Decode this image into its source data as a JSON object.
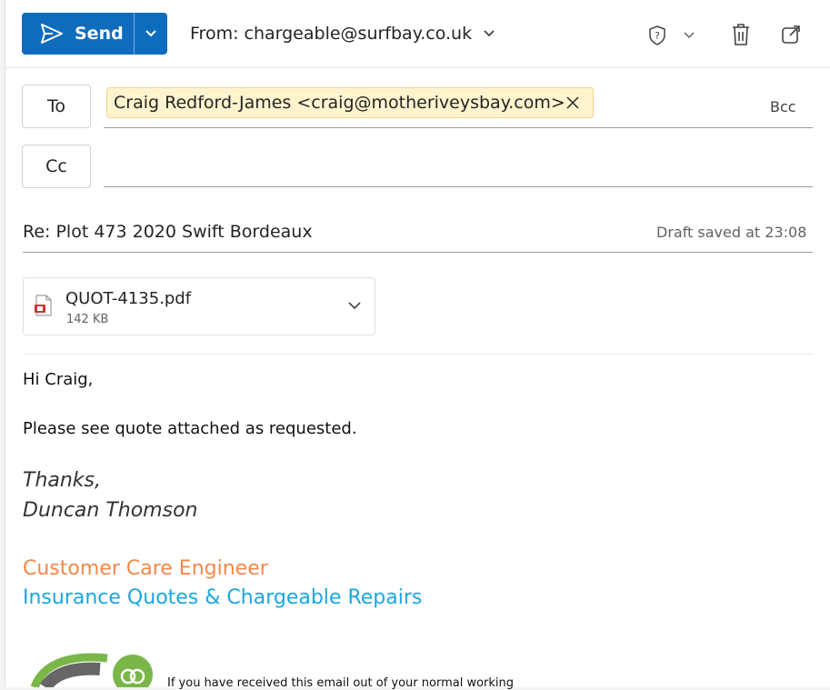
{
  "toolbar": {
    "send_label": "Send",
    "from_label": "From: chargeable@surfbay.co.uk"
  },
  "recipients": {
    "to_label": "To",
    "cc_label": "Cc",
    "bcc_label": "Bcc",
    "to_pill": "Craig Redford-James <craig@motheriveysbay.com>"
  },
  "subject": {
    "text": "Re: Plot 473 2020 Swift Bordeaux",
    "draft_status": "Draft saved at 23:08"
  },
  "attachment": {
    "name": "QUOT-4135.pdf",
    "size": "142 KB"
  },
  "body": {
    "greeting": "Hi Craig,",
    "message": "Please see quote attached as requested.",
    "closing": "Thanks,",
    "sender": "Duncan Thomson",
    "role": "Customer Care Engineer",
    "department": "Insurance Quotes & Chargeable Repairs",
    "disclaimer": "If you have received this email out of your normal working"
  },
  "colors": {
    "accent": "#0f6cbd",
    "pill_bg": "#fff4ce",
    "role_color": "#f2884b",
    "department_color": "#1aa7e0"
  }
}
